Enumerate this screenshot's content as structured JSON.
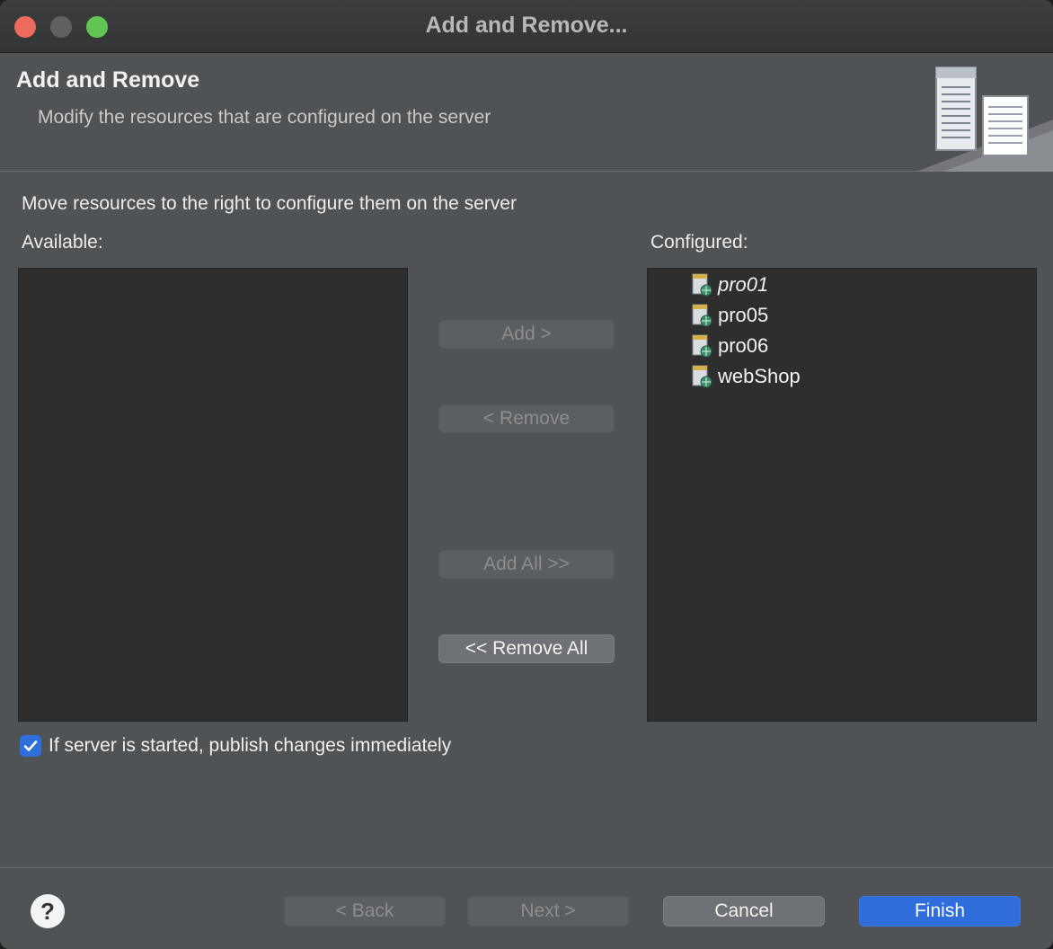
{
  "window": {
    "title": "Add and Remove..."
  },
  "header": {
    "title": "Add and Remove",
    "subtitle": "Modify the resources that are configured on the server"
  },
  "main": {
    "instruction": "Move resources to the right to configure them on the server",
    "available_label": "Available:",
    "configured_label": "Configured:",
    "available_items": [],
    "configured_items": [
      {
        "label": "pro01",
        "italic": true,
        "icon": "web-project-icon"
      },
      {
        "label": "pro05",
        "italic": false,
        "icon": "web-project-icon"
      },
      {
        "label": "pro06",
        "italic": false,
        "icon": "web-project-icon"
      },
      {
        "label": "webShop",
        "italic": false,
        "icon": "web-project-icon"
      }
    ]
  },
  "buttons": {
    "add": "Add >",
    "remove": "< Remove",
    "add_all": "Add All >>",
    "remove_all": "<< Remove All"
  },
  "options": {
    "publish_label": "If server is started, publish changes immediately",
    "publish_checked": true
  },
  "footer": {
    "help": "?",
    "back": "< Back",
    "next": "Next >",
    "cancel": "Cancel",
    "finish": "Finish"
  },
  "colors": {
    "accent": "#2e6ddb",
    "window_bg": "#505356",
    "list_bg": "#2e2e2e"
  }
}
